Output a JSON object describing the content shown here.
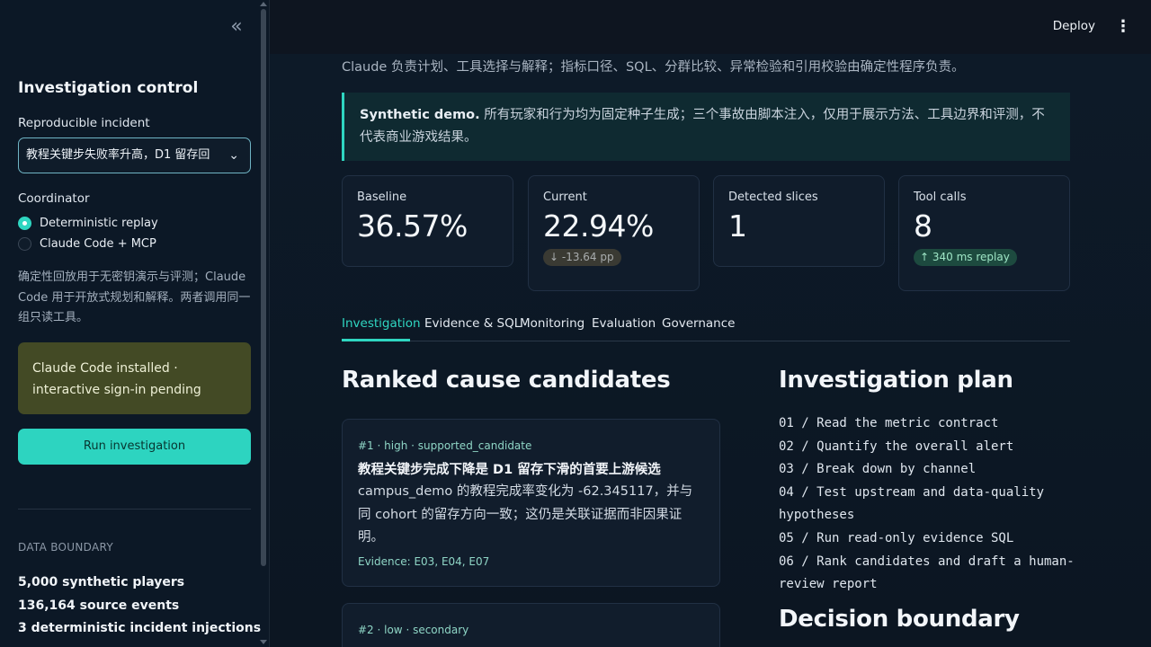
{
  "sidebar": {
    "collapse_icon": "double-chevron-left-icon",
    "title": "Investigation control",
    "incident_label": "Reproducible incident",
    "incident_value": "教程关键步失败率升高，D1 留存回",
    "coordinator_label": "Coordinator",
    "coordinator_options": [
      {
        "label": "Deterministic replay",
        "selected": true
      },
      {
        "label": "Claude Code + MCP",
        "selected": false
      }
    ],
    "note": "确定性回放用于无密钥演示与评测；Claude Code 用于开放式规划和解释。两者调用同一组只读工具。",
    "status": "Claude Code installed · interactive sign-in pending",
    "run_label": "Run investigation",
    "boundary_caption": "DATA BOUNDARY",
    "stats": [
      "5,000 synthetic players",
      "136,164 source events",
      "3 deterministic incident injections"
    ]
  },
  "topbar": {
    "deploy_label": "Deploy",
    "menu_icon": "kebab-menu-icon"
  },
  "main": {
    "intro": "Claude 负责计划、工具选择与解释；指标口径、SQL、分群比较、异常检验和引用校验由确定性程序负责。",
    "notice_bold": "Synthetic demo.",
    "notice_text": " 所有玩家和行为均为固定种子生成；三个事故由脚本注入，仅用于展示方法、工具边界和评测，不代表商业游戏结果。",
    "kpis": [
      {
        "label": "Baseline",
        "value": "36.57%"
      },
      {
        "label": "Current",
        "value": "22.94%",
        "delta": "↓ -13.64 pp",
        "delta_dir": "down"
      },
      {
        "label": "Detected slices",
        "value": "1"
      },
      {
        "label": "Tool calls",
        "value": "8",
        "delta": "↑ 340 ms replay",
        "delta_dir": "up"
      }
    ],
    "tabs": [
      "Investigation",
      "Evidence & SQL",
      "Monitoring",
      "Evaluation",
      "Governance"
    ],
    "active_tab": "Investigation",
    "candidates_heading": "Ranked cause candidates",
    "candidates": [
      {
        "meta": "#1 · high · supported_candidate",
        "title": "教程关键步完成下降是 D1 留存下滑的首要上游候选",
        "body": "campus_demo 的教程完成率变化为 -62.345117，并与同 cohort 的留存方向一致；这仍是关联证据而非因果证明。",
        "evidence": "Evidence: E03, E04, E07"
      },
      {
        "meta": "#2 · low · secondary",
        "title": "",
        "body": "",
        "evidence": ""
      }
    ],
    "plan_heading": "Investigation plan",
    "plan_steps": [
      "01 / Read the metric contract",
      "02 / Quantify the overall alert",
      "03 / Break down by channel",
      "04 / Test upstream and data-quality hypotheses",
      "05 / Run read-only evidence SQL",
      "06 / Rank candidates and draft a human-review report"
    ],
    "decision_heading": "Decision boundary"
  },
  "colors": {
    "accent": "#2dd4c0",
    "status_bg": "#434a25",
    "background": "#0e1520"
  }
}
